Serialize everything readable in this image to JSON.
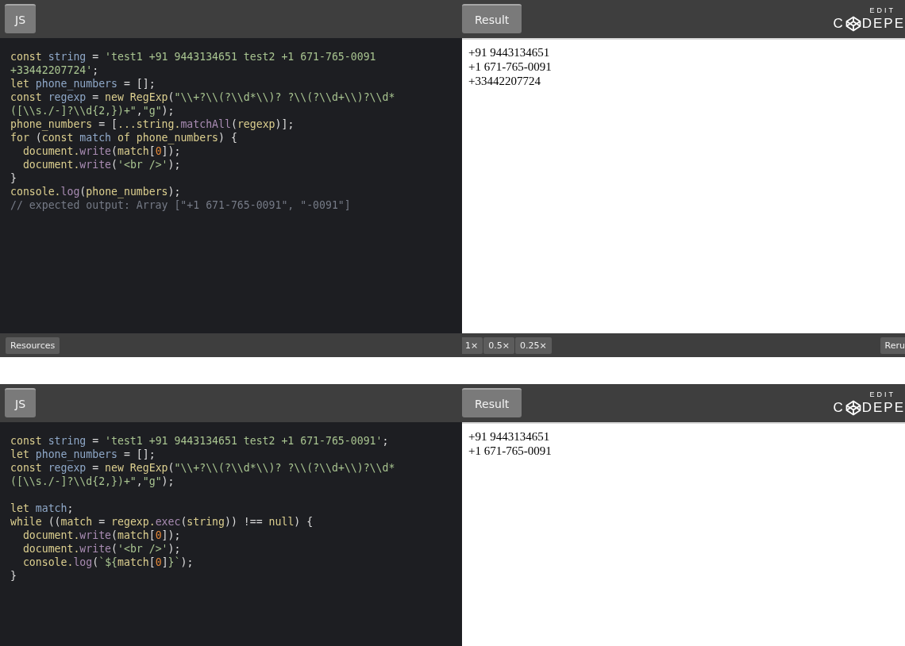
{
  "embeds": [
    {
      "code_tab": "JS",
      "result_tab": "Result",
      "logo": {
        "caption": "EDIT",
        "left": "C",
        "right": "DEPE"
      },
      "code_lines": [
        {
          "kind": "code",
          "tokens": [
            {
              "text": "const ",
              "kind": "kw"
            },
            {
              "text": "string",
              "kind": "def"
            },
            {
              "text": " = ",
              "kind": "plain"
            },
            {
              "text": "'test1 +91 9443134651 test2 +1 671-765-0091",
              "kind": "str"
            }
          ]
        },
        {
          "kind": "code",
          "tokens": [
            {
              "text": "+33442207724'",
              "kind": "str"
            },
            {
              "text": ";",
              "kind": "plain"
            }
          ]
        },
        {
          "kind": "code",
          "tokens": [
            {
              "text": "let ",
              "kind": "kw"
            },
            {
              "text": "phone_numbers",
              "kind": "def"
            },
            {
              "text": " = [];",
              "kind": "plain"
            }
          ]
        },
        {
          "kind": "code",
          "tokens": [
            {
              "text": "const ",
              "kind": "kw"
            },
            {
              "text": "regexp",
              "kind": "def"
            },
            {
              "text": " = ",
              "kind": "plain"
            },
            {
              "text": "new RegExp",
              "kind": "kw"
            },
            {
              "text": "(",
              "kind": "plain"
            },
            {
              "text": "\"\\\\+?\\\\(?\\\\d*\\\\)? ?\\\\(?\\\\d+\\\\)?\\\\d*",
              "kind": "str"
            }
          ]
        },
        {
          "kind": "code",
          "tokens": [
            {
              "text": "([\\\\s./-]?\\\\d{2,})+\"",
              "kind": "str"
            },
            {
              "text": ",",
              "kind": "plain"
            },
            {
              "text": "\"g\"",
              "kind": "str"
            },
            {
              "text": ");",
              "kind": "plain"
            }
          ]
        },
        {
          "kind": "code",
          "tokens": [
            {
              "text": "phone_numbers",
              "kind": "kw"
            },
            {
              "text": " = [",
              "kind": "plain"
            },
            {
              "text": "...string.",
              "kind": "kw"
            },
            {
              "text": "matchAll",
              "kind": "fn"
            },
            {
              "text": "(",
              "kind": "plain"
            },
            {
              "text": "regexp",
              "kind": "kw"
            },
            {
              "text": ")];",
              "kind": "plain"
            }
          ]
        },
        {
          "kind": "code",
          "tokens": [
            {
              "text": "for",
              "kind": "kw"
            },
            {
              "text": " (",
              "kind": "plain"
            },
            {
              "text": "const ",
              "kind": "kw"
            },
            {
              "text": "match",
              "kind": "def"
            },
            {
              "text": " of phone_numbers",
              "kind": "kw"
            },
            {
              "text": ") {",
              "kind": "plain"
            }
          ]
        },
        {
          "kind": "code",
          "indent": true,
          "tokens": [
            {
              "text": "document.",
              "kind": "kw"
            },
            {
              "text": "write",
              "kind": "fn"
            },
            {
              "text": "(",
              "kind": "plain"
            },
            {
              "text": "match",
              "kind": "kw"
            },
            {
              "text": "[",
              "kind": "plain"
            },
            {
              "text": "0",
              "kind": "num"
            },
            {
              "text": "]);",
              "kind": "plain"
            }
          ]
        },
        {
          "kind": "code",
          "indent": true,
          "tokens": [
            {
              "text": "document.",
              "kind": "kw"
            },
            {
              "text": "write",
              "kind": "fn"
            },
            {
              "text": "(",
              "kind": "plain"
            },
            {
              "text": "'<br />'",
              "kind": "str"
            },
            {
              "text": ");",
              "kind": "plain"
            }
          ]
        },
        {
          "kind": "code",
          "tokens": [
            {
              "text": "}",
              "kind": "plain"
            }
          ]
        },
        {
          "kind": "code",
          "tokens": [
            {
              "text": "console.",
              "kind": "kw"
            },
            {
              "text": "log",
              "kind": "fn"
            },
            {
              "text": "(",
              "kind": "plain"
            },
            {
              "text": "phone_numbers",
              "kind": "kw"
            },
            {
              "text": ");",
              "kind": "plain"
            }
          ]
        },
        {
          "kind": "code",
          "tokens": [
            {
              "text": "// expected output: Array [\"+1 671-765-0091\", \"-0091\"]",
              "kind": "com"
            }
          ]
        }
      ],
      "result_lines": [
        "+91 9443134651",
        "+1 671-765-0091",
        "+33442207724"
      ],
      "footer": {
        "resources": "Resources",
        "zooms": [
          "1×",
          "0.5×",
          "0.25×"
        ],
        "rerun": "Reru"
      }
    },
    {
      "code_tab": "JS",
      "result_tab": "Result",
      "logo": {
        "caption": "EDIT",
        "left": "C",
        "right": "DEPE"
      },
      "code_lines": [
        {
          "kind": "code",
          "tokens": [
            {
              "text": "const ",
              "kind": "kw"
            },
            {
              "text": "string",
              "kind": "def"
            },
            {
              "text": " = ",
              "kind": "plain"
            },
            {
              "text": "'test1 +91 9443134651 test2 +1 671-765-0091'",
              "kind": "str"
            },
            {
              "text": ";",
              "kind": "plain"
            }
          ]
        },
        {
          "kind": "code",
          "tokens": [
            {
              "text": "let ",
              "kind": "kw"
            },
            {
              "text": "phone_numbers",
              "kind": "def"
            },
            {
              "text": " = [];",
              "kind": "plain"
            }
          ]
        },
        {
          "kind": "code",
          "tokens": [
            {
              "text": "const ",
              "kind": "kw"
            },
            {
              "text": "regexp",
              "kind": "def"
            },
            {
              "text": " = ",
              "kind": "plain"
            },
            {
              "text": "new RegExp",
              "kind": "kw"
            },
            {
              "text": "(",
              "kind": "plain"
            },
            {
              "text": "\"\\\\+?\\\\(?\\\\d*\\\\)? ?\\\\(?\\\\d+\\\\)?\\\\d*",
              "kind": "str"
            }
          ]
        },
        {
          "kind": "code",
          "tokens": [
            {
              "text": "([\\\\s./-]?\\\\d{2,})+\"",
              "kind": "str"
            },
            {
              "text": ",",
              "kind": "plain"
            },
            {
              "text": "\"g\"",
              "kind": "str"
            },
            {
              "text": ");",
              "kind": "plain"
            }
          ]
        },
        {
          "kind": "blank"
        },
        {
          "kind": "code",
          "tokens": [
            {
              "text": "let ",
              "kind": "kw"
            },
            {
              "text": "match",
              "kind": "def"
            },
            {
              "text": ";",
              "kind": "plain"
            }
          ]
        },
        {
          "kind": "code",
          "tokens": [
            {
              "text": "while",
              "kind": "kw"
            },
            {
              "text": " ((",
              "kind": "plain"
            },
            {
              "text": "match",
              "kind": "kw"
            },
            {
              "text": " = ",
              "kind": "plain"
            },
            {
              "text": "regexp.",
              "kind": "kw"
            },
            {
              "text": "exec",
              "kind": "fn"
            },
            {
              "text": "(",
              "kind": "plain"
            },
            {
              "text": "string",
              "kind": "kw"
            },
            {
              "text": ")) !== ",
              "kind": "plain"
            },
            {
              "text": "null",
              "kind": "kw"
            },
            {
              "text": ") {",
              "kind": "plain"
            }
          ]
        },
        {
          "kind": "code",
          "indent": true,
          "tokens": [
            {
              "text": "document.",
              "kind": "kw"
            },
            {
              "text": "write",
              "kind": "fn"
            },
            {
              "text": "(",
              "kind": "plain"
            },
            {
              "text": "match",
              "kind": "kw"
            },
            {
              "text": "[",
              "kind": "plain"
            },
            {
              "text": "0",
              "kind": "num"
            },
            {
              "text": "]);",
              "kind": "plain"
            }
          ]
        },
        {
          "kind": "code",
          "indent": true,
          "tokens": [
            {
              "text": "document.",
              "kind": "kw"
            },
            {
              "text": "write",
              "kind": "fn"
            },
            {
              "text": "(",
              "kind": "plain"
            },
            {
              "text": "'<br />'",
              "kind": "str"
            },
            {
              "text": ");",
              "kind": "plain"
            }
          ]
        },
        {
          "kind": "code",
          "indent": true,
          "tokens": [
            {
              "text": "console.",
              "kind": "kw"
            },
            {
              "text": "log",
              "kind": "fn"
            },
            {
              "text": "(",
              "kind": "plain"
            },
            {
              "text": "`${",
              "kind": "str"
            },
            {
              "text": "match",
              "kind": "kw"
            },
            {
              "text": "[",
              "kind": "plain"
            },
            {
              "text": "0",
              "kind": "num"
            },
            {
              "text": "]",
              "kind": "plain"
            },
            {
              "text": "}`",
              "kind": "str"
            },
            {
              "text": ");",
              "kind": "plain"
            }
          ]
        },
        {
          "kind": "code",
          "tokens": [
            {
              "text": "}",
              "kind": "plain"
            }
          ]
        }
      ],
      "result_lines": [
        "+91 9443134651",
        "+1 671-765-0091"
      ]
    }
  ]
}
